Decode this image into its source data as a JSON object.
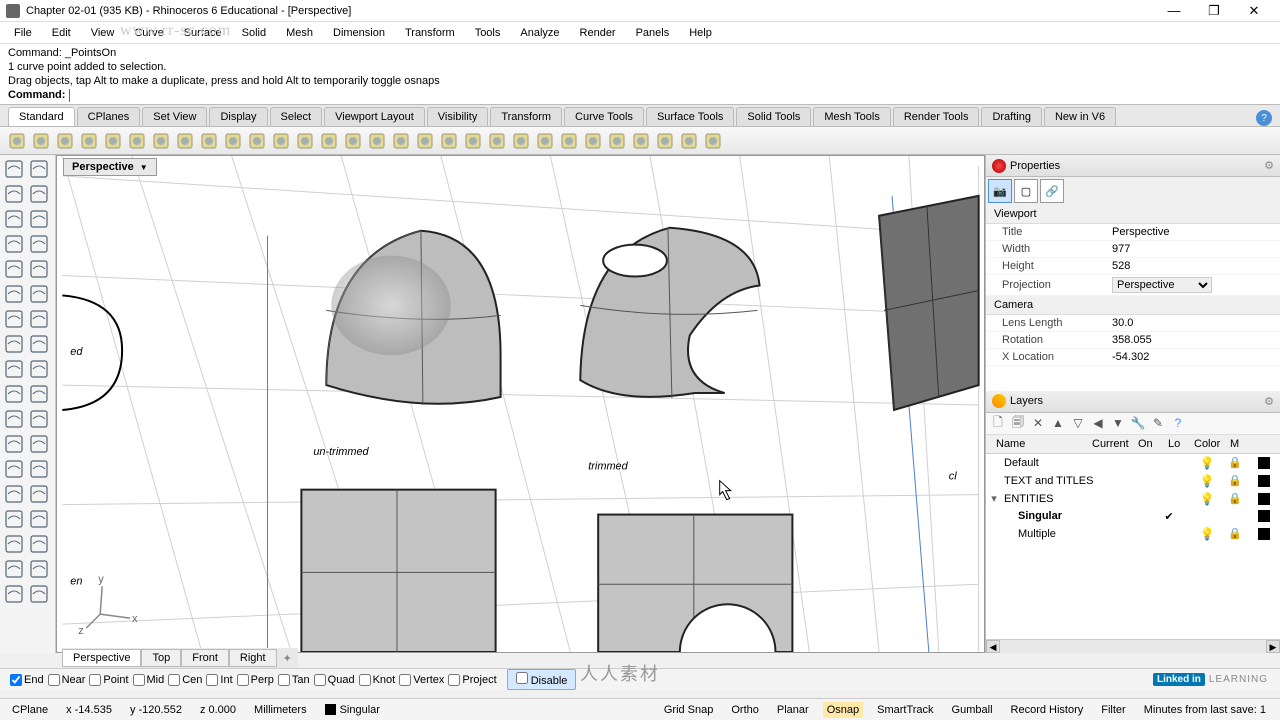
{
  "title": "Chapter 02-01 (935 KB) - Rhinoceros 6 Educational - [Perspective]",
  "menu": [
    "File",
    "Edit",
    "View",
    "Curve",
    "Surface",
    "Solid",
    "Mesh",
    "Dimension",
    "Transform",
    "Tools",
    "Analyze",
    "Render",
    "Panels",
    "Help"
  ],
  "cmd": {
    "l1": "Command: _PointsOn",
    "l2": "1 curve point added to selection.",
    "l3": "Drag objects, tap Alt to make a duplicate, press and hold Alt to temporarily toggle osnaps",
    "prompt": "Command:"
  },
  "tabs": [
    "Standard",
    "CPlanes",
    "Set View",
    "Display",
    "Select",
    "Viewport Layout",
    "Visibility",
    "Transform",
    "Curve Tools",
    "Surface Tools",
    "Solid Tools",
    "Mesh Tools",
    "Render Tools",
    "Drafting",
    "New in V6"
  ],
  "vp": {
    "label": "Perspective",
    "text_untrimmed": "un-trimmed",
    "text_trimmed": "trimmed",
    "text_ed": "ed",
    "text_en": "en",
    "text_cl": "cl"
  },
  "props": {
    "title": "Properties",
    "sec1": "Viewport",
    "rows1": [
      {
        "l": "Title",
        "v": "Perspective"
      },
      {
        "l": "Width",
        "v": "977"
      },
      {
        "l": "Height",
        "v": "528"
      },
      {
        "l": "Projection",
        "v": "Perspective"
      }
    ],
    "sec2": "Camera",
    "rows2": [
      {
        "l": "Lens Length",
        "v": "30.0"
      },
      {
        "l": "Rotation",
        "v": "358.055"
      },
      {
        "l": "X Location",
        "v": "-54.302"
      }
    ]
  },
  "layers": {
    "title": "Layers",
    "cols": [
      "Name",
      "Current",
      "On",
      "Lo",
      "Color",
      "M"
    ],
    "rows": [
      {
        "n": "Default",
        "i": 0,
        "cur": false,
        "on": true,
        "lock": true
      },
      {
        "n": "TEXT and TITLES",
        "i": 0,
        "cur": false,
        "on": true,
        "lock": true
      },
      {
        "n": "ENTITIES",
        "i": 0,
        "cur": false,
        "on": true,
        "lock": true,
        "exp": "▾"
      },
      {
        "n": "Singular",
        "i": 1,
        "cur": true,
        "on": false,
        "lock": false,
        "bold": true
      },
      {
        "n": "Multiple",
        "i": 1,
        "cur": false,
        "on": true,
        "lock": true
      }
    ]
  },
  "vtabs": [
    "Perspective",
    "Top",
    "Front",
    "Right"
  ],
  "osnaps": [
    {
      "l": "End",
      "c": true
    },
    {
      "l": "Near",
      "c": false
    },
    {
      "l": "Point",
      "c": false
    },
    {
      "l": "Mid",
      "c": false
    },
    {
      "l": "Cen",
      "c": false
    },
    {
      "l": "Int",
      "c": false
    },
    {
      "l": "Perp",
      "c": false
    },
    {
      "l": "Tan",
      "c": false
    },
    {
      "l": "Quad",
      "c": false
    },
    {
      "l": "Knot",
      "c": false
    },
    {
      "l": "Vertex",
      "c": false
    },
    {
      "l": "Project",
      "c": false
    }
  ],
  "osnap_disable": "Disable",
  "watermark_top": "www.rr-sc.com",
  "watermark_mid": "人人素材",
  "linkedin": "Linked in LEARNING",
  "status": {
    "l": [
      {
        "t": "CPlane"
      },
      {
        "t": "x -14.535"
      },
      {
        "t": "y -120.552"
      },
      {
        "t": "z 0.000"
      },
      {
        "t": "Millimeters"
      },
      {
        "t": "Singular",
        "sq": true
      },
      {
        "t": ""
      }
    ],
    "r": [
      "Grid Snap",
      "Ortho",
      "Planar",
      "Osnap",
      "SmartTrack",
      "Gumball",
      "Record History",
      "Filter",
      "Minutes from last save: 1"
    ]
  }
}
